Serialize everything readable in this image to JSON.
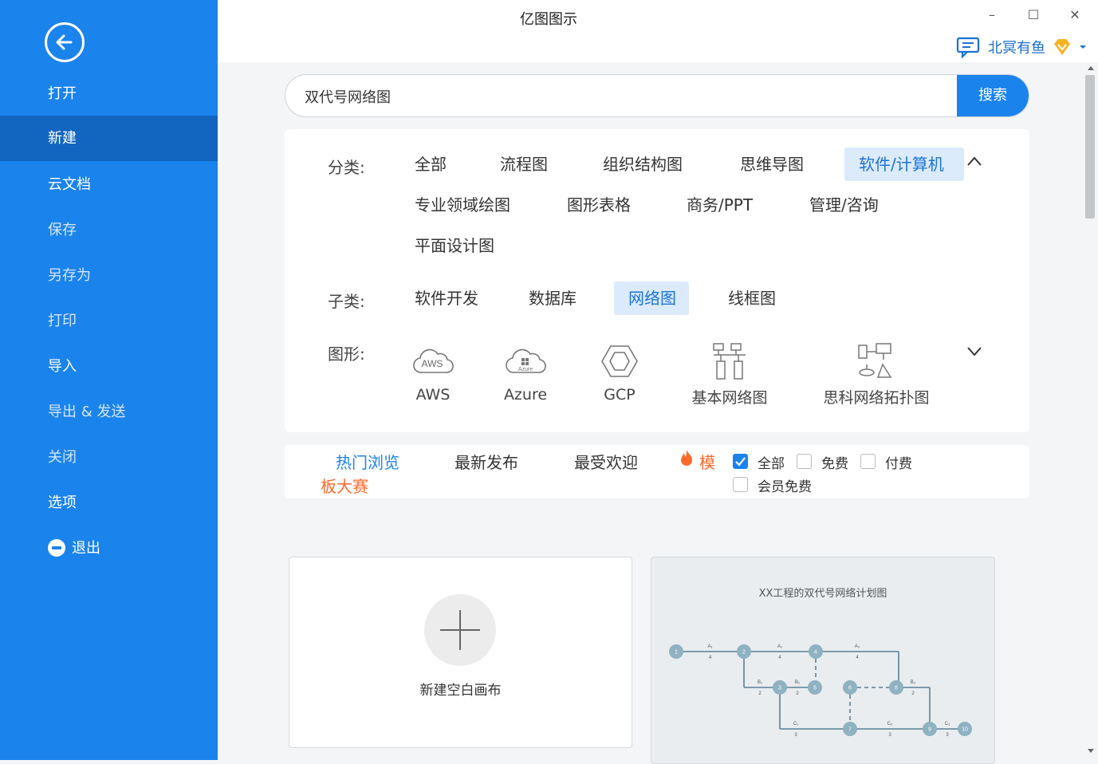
{
  "window": {
    "title": "亿图图示",
    "minimize": "–",
    "maximize": "☐",
    "close": "✕"
  },
  "user": {
    "name": "北冥有鱼"
  },
  "sidebar": {
    "items": [
      {
        "label": "打开"
      },
      {
        "label": "新建"
      },
      {
        "label": "云文档"
      },
      {
        "label": "保存"
      },
      {
        "label": "另存为"
      },
      {
        "label": "打印"
      },
      {
        "label": "导入"
      },
      {
        "label": "导出 & 发送"
      },
      {
        "label": "关闭"
      },
      {
        "label": "选项"
      },
      {
        "label": "退出"
      }
    ]
  },
  "search": {
    "value": "双代号网络图",
    "button": "搜索"
  },
  "filters": {
    "category_label": "分类:",
    "categories": [
      "全部",
      "流程图",
      "组织结构图",
      "思维导图",
      "软件/计算机",
      "专业领域绘图",
      "图形表格",
      "商务/PPT",
      "管理/咨询",
      "平面设计图"
    ],
    "subcategory_label": "子类:",
    "subcategories": [
      "软件开发",
      "数据库",
      "网络图",
      "线框图"
    ],
    "shape_label": "图形:",
    "shapes": [
      {
        "name": "AWS",
        "icon_text": "AWS"
      },
      {
        "name": "Azure",
        "icon_text": "Azure"
      },
      {
        "name": "GCP"
      },
      {
        "name": "基本网络图"
      },
      {
        "name": "思科网络拓扑图"
      }
    ]
  },
  "tabs": {
    "hot": "热门浏览",
    "latest": "最新发布",
    "popular": "最受欢迎",
    "contest_a": "模",
    "contest_b": "板大赛",
    "checks": [
      "全部",
      "免费",
      "付费",
      "会员免费"
    ]
  },
  "cards": {
    "blank_label": "新建空白画布",
    "template_title": "XX工程的双代号网络计划图",
    "diagram": {
      "nodes": [
        "1",
        "2",
        "3",
        "4",
        "5",
        "6",
        "7",
        "8",
        "9",
        "10"
      ],
      "arrow_labels": [
        "A₁",
        "A₂",
        "A₃",
        "B₁",
        "B₂",
        "B₃",
        "C₁",
        "C₂",
        "C₃"
      ],
      "durations": [
        "4",
        "4",
        "4",
        "2",
        "2",
        "2",
        "3",
        "3",
        "3"
      ]
    }
  },
  "colors": {
    "accent": "#1b83ec",
    "sidebar_active": "#1266c0",
    "hot_orange": "#ff6a2b"
  }
}
